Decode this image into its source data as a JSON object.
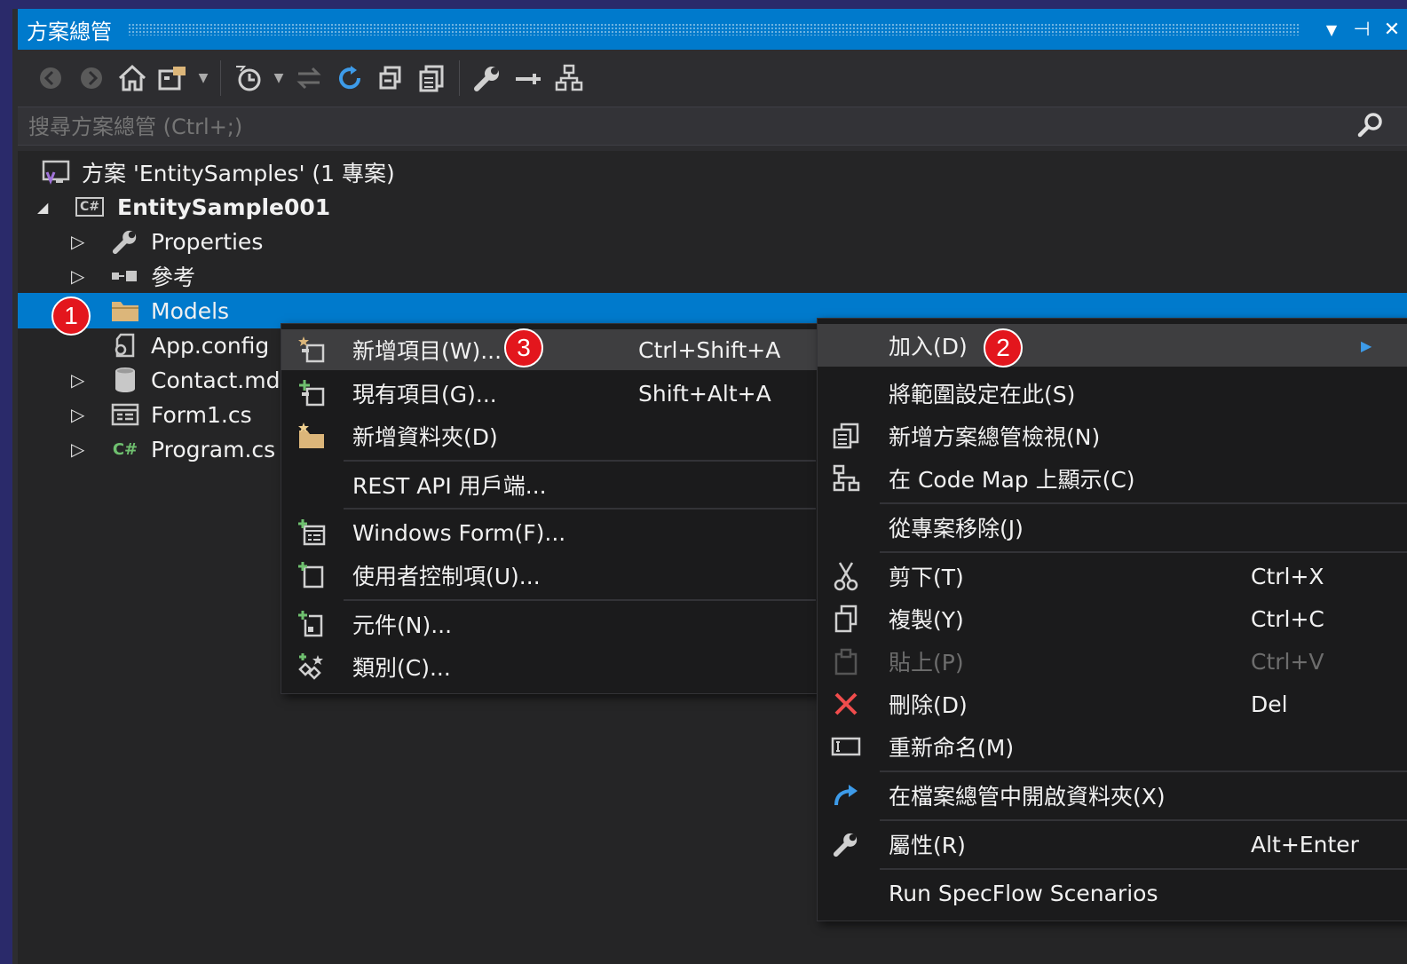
{
  "window": {
    "title": "方案總管",
    "dropdown_glyph": "▼",
    "pin_glyph": "⊣",
    "close_glyph": "✕"
  },
  "toolbar": {
    "icons": [
      "back-icon",
      "forward-icon",
      "home-icon",
      "switch-views-icon",
      "pending-changes-filter-icon",
      "sync-icon",
      "refresh-icon",
      "collapse-all-icon",
      "show-all-files-icon",
      "properties-icon",
      "preview-icon",
      "code-map-icon"
    ]
  },
  "search": {
    "placeholder": "搜尋方案總管 (Ctrl+;)"
  },
  "tree": {
    "solution": "方案 'EntitySamples' (1 專案)",
    "project": "EntitySample001",
    "project_badge": "C#",
    "items": [
      {
        "label": "Properties"
      },
      {
        "label": "參考"
      },
      {
        "label": "Models"
      },
      {
        "label": "App.config"
      },
      {
        "label": "Contact.md"
      },
      {
        "label": "Form1.cs"
      },
      {
        "label": "Program.cs"
      }
    ],
    "program_badge": "C#"
  },
  "badges": {
    "one": "1",
    "two": "2",
    "three": "3"
  },
  "context_menu": {
    "items": [
      {
        "label": "加入(D)",
        "shortcut": "",
        "submenu_arrow": "▶"
      },
      {
        "label": "將範圍設定在此(S)",
        "shortcut": ""
      },
      {
        "label": "新增方案總管檢視(N)",
        "shortcut": ""
      },
      {
        "label": "在 Code Map 上顯示(C)",
        "shortcut": ""
      },
      {
        "label": "從專案移除(J)",
        "shortcut": ""
      },
      {
        "label": "剪下(T)",
        "shortcut": "Ctrl+X"
      },
      {
        "label": "複製(Y)",
        "shortcut": "Ctrl+C"
      },
      {
        "label": "貼上(P)",
        "shortcut": "Ctrl+V"
      },
      {
        "label": "刪除(D)",
        "shortcut": "Del"
      },
      {
        "label": "重新命名(M)",
        "shortcut": ""
      },
      {
        "label": "在檔案總管中開啟資料夾(X)",
        "shortcut": ""
      },
      {
        "label": "屬性(R)",
        "shortcut": "Alt+Enter"
      },
      {
        "label": "Run SpecFlow Scenarios",
        "shortcut": ""
      }
    ]
  },
  "add_submenu": {
    "items": [
      {
        "label": "新增項目(W)...",
        "shortcut": "Ctrl+Shift+A"
      },
      {
        "label": "現有項目(G)...",
        "shortcut": "Shift+Alt+A"
      },
      {
        "label": "新增資料夾(D)",
        "shortcut": ""
      },
      {
        "label": "REST API 用戶端...",
        "shortcut": ""
      },
      {
        "label": "Windows Form(F)...",
        "shortcut": ""
      },
      {
        "label": "使用者控制項(U)...",
        "shortcut": ""
      },
      {
        "label": "元件(N)...",
        "shortcut": ""
      },
      {
        "label": "類別(C)...",
        "shortcut": ""
      }
    ]
  },
  "colors": {
    "accent": "#007acc",
    "badge_red": "#e3161d",
    "delete_red": "#f14c4c",
    "folder_yellow": "#dcb67a"
  }
}
